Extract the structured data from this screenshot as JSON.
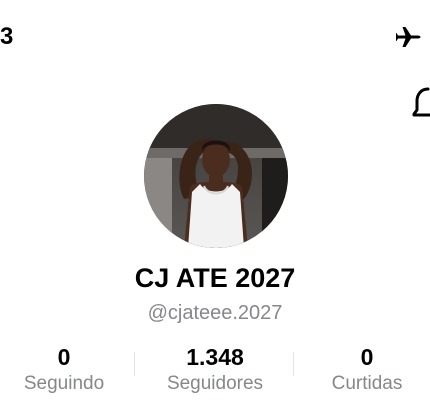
{
  "status_bar": {
    "time": "3",
    "airplane_icon": "airplane-icon"
  },
  "header": {
    "notifications_icon": "bell-icon"
  },
  "profile": {
    "avatar_icon": "avatar",
    "display_name": "CJ ATE 2027",
    "username": "@cjateee.2027"
  },
  "stats": {
    "following": {
      "value": "0",
      "label": "Seguindo"
    },
    "followers": {
      "value": "1.348",
      "label": "Seguidores"
    },
    "likes": {
      "value": "0",
      "label": "Curtidas"
    }
  },
  "colors": {
    "primary_text": "#000000",
    "secondary_text": "#86878b",
    "divider": "#e3e3e4",
    "background": "#ffffff"
  }
}
